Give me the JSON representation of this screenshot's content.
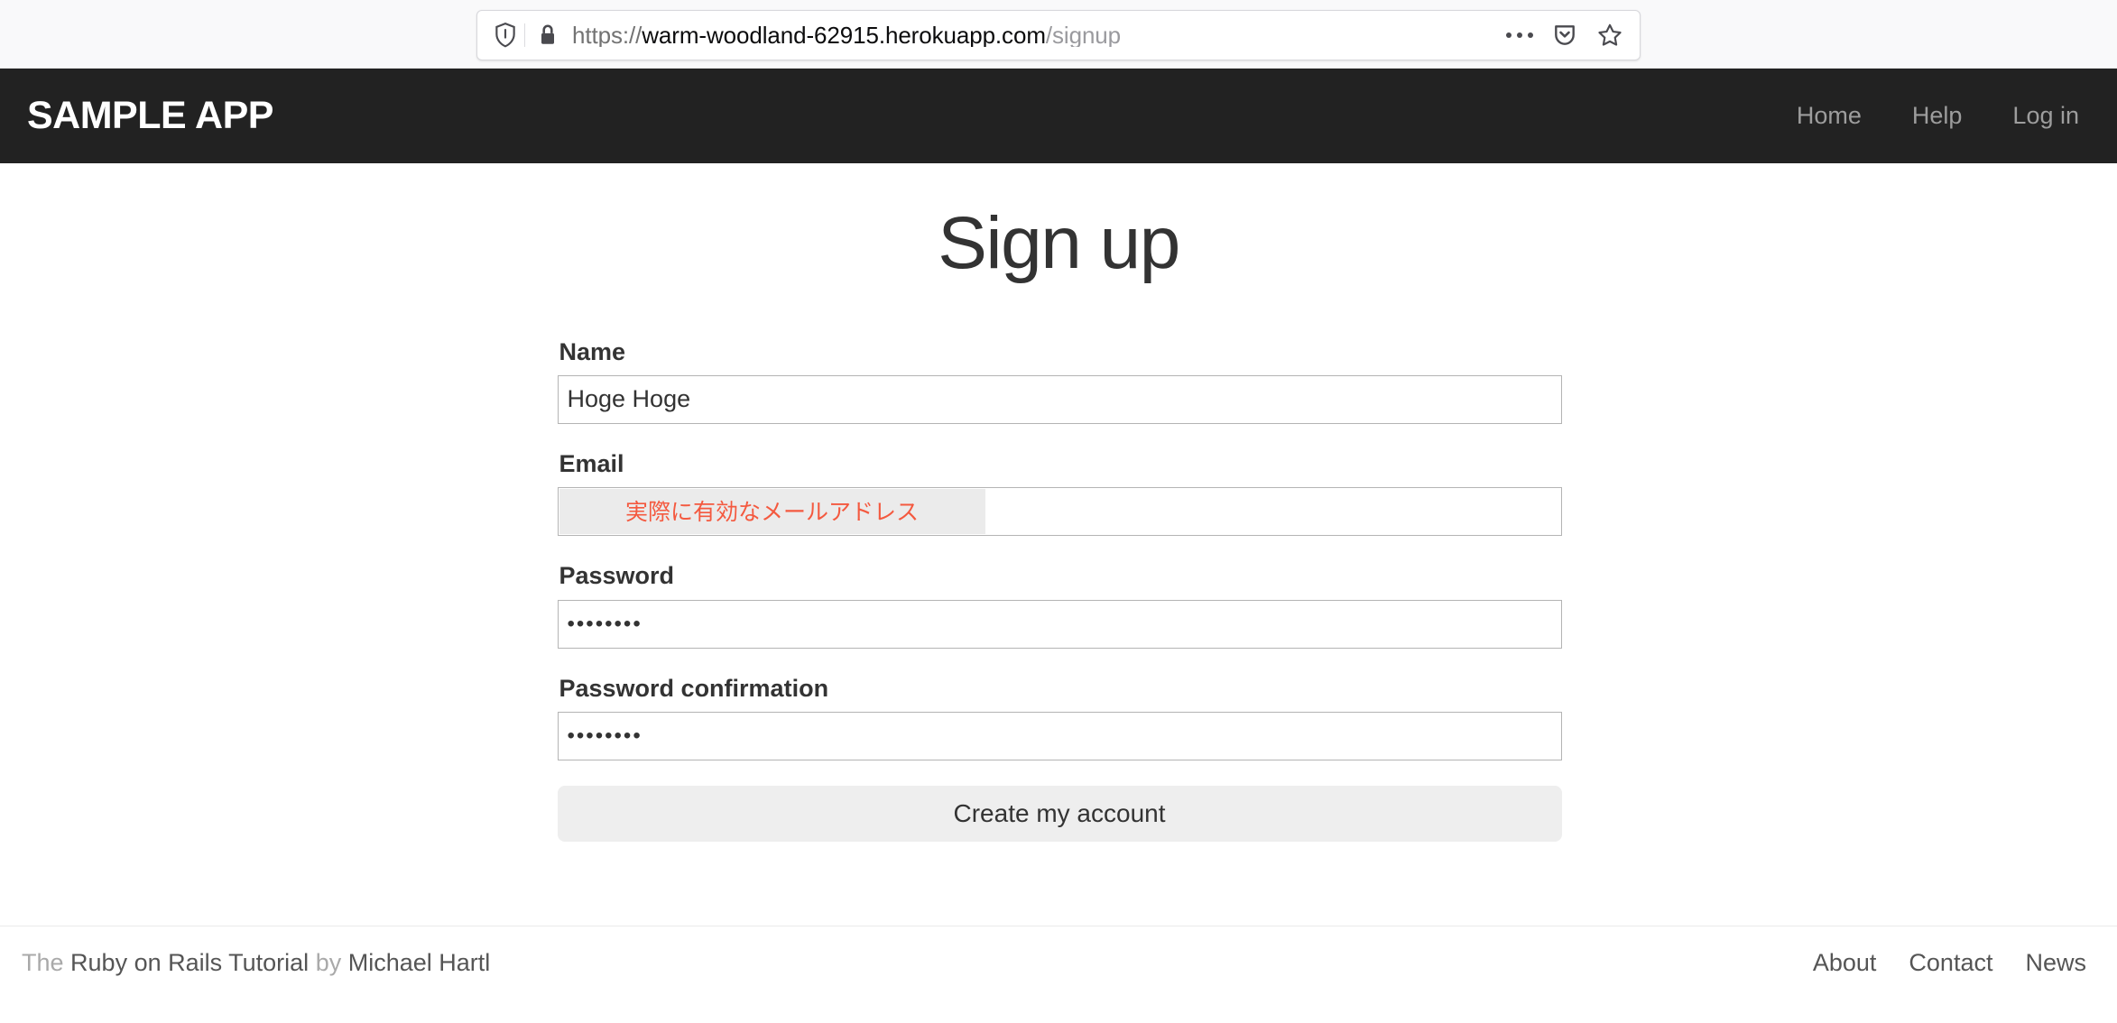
{
  "browser": {
    "url": {
      "scheme": "https://",
      "host": "warm-woodland-62915.herokuapp.com",
      "path": "/signup",
      "full": "https://warm-woodland-62915.herokuapp.com/signup"
    },
    "icons": {
      "tracking_protection": "shield-icon",
      "site_security": "lock-icon",
      "page_actions": "ellipsis-icon",
      "pocket": "pocket-icon",
      "bookmark": "star-icon"
    }
  },
  "navbar": {
    "brand": "SAMPLE APP",
    "links": [
      {
        "label": "Home"
      },
      {
        "label": "Help"
      },
      {
        "label": "Log in"
      }
    ],
    "background_color": "#222222",
    "link_color": "#9d9d9d"
  },
  "main": {
    "title": "Sign up",
    "form": {
      "fields": [
        {
          "label": "Name",
          "value": "Hoge Hoge",
          "type": "text",
          "placeholder": ""
        },
        {
          "label": "Email",
          "value": "",
          "type": "email",
          "placeholder": "",
          "ime_text": "実際に有効なメールアドレス",
          "ime_text_color": "#f4593f",
          "ime_highlight_color": "#ebebeb"
        },
        {
          "label": "Password",
          "value": "••••••••",
          "type": "password",
          "placeholder": ""
        },
        {
          "label": "Password confirmation",
          "value": "••••••••",
          "type": "password",
          "placeholder": ""
        }
      ],
      "submit_label": "Create my account"
    }
  },
  "footer": {
    "prefix": "The",
    "tutorial_link": "Ruby on Rails Tutorial",
    "by": "by",
    "author_link": "Michael Hartl",
    "links": [
      {
        "label": "About"
      },
      {
        "label": "Contact"
      },
      {
        "label": "News"
      }
    ]
  }
}
